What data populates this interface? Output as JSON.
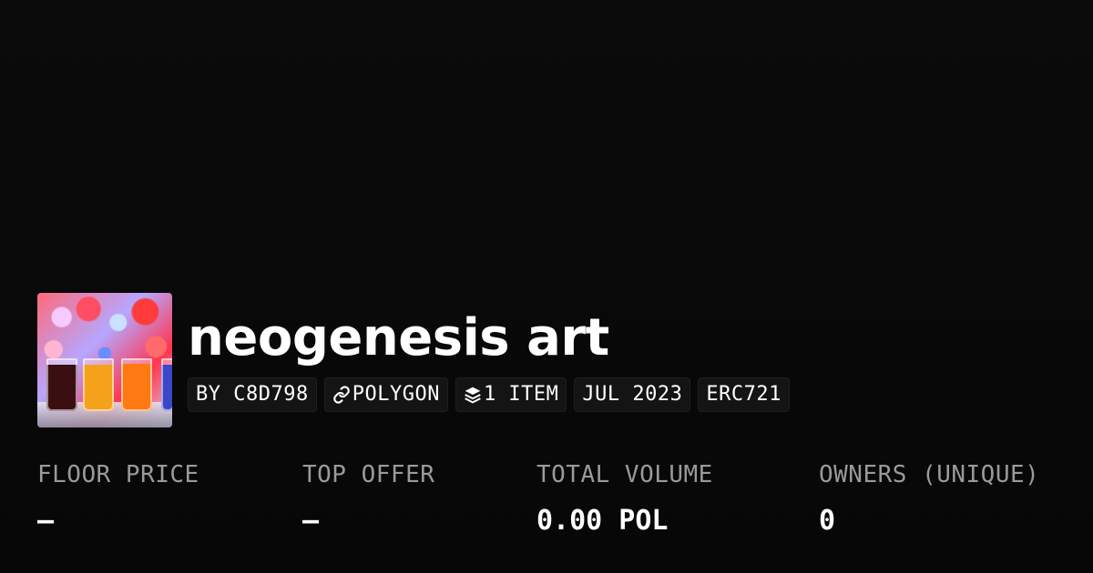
{
  "collection": {
    "title": "neogenesis art",
    "thumbnail_alt": "collection-thumbnail",
    "badges": {
      "creator": "BY C8D798",
      "chain": "POLYGON",
      "items": "1 ITEM",
      "date": "JUL 2023",
      "standard": "ERC721"
    },
    "icons": {
      "chain_icon": "link-icon",
      "items_icon": "layers-icon"
    }
  },
  "stats": [
    {
      "label": "FLOOR PRICE",
      "value": "–"
    },
    {
      "label": "TOP OFFER",
      "value": "–"
    },
    {
      "label": "TOTAL VOLUME",
      "value": "0.00 POL"
    },
    {
      "label": "OWNERS (UNIQUE)",
      "value": "0"
    }
  ],
  "colors": {
    "background": "#0a0a0a",
    "badge_background": "#141414",
    "label_color": "#9a9a9a",
    "text_color": "#ffffff"
  }
}
